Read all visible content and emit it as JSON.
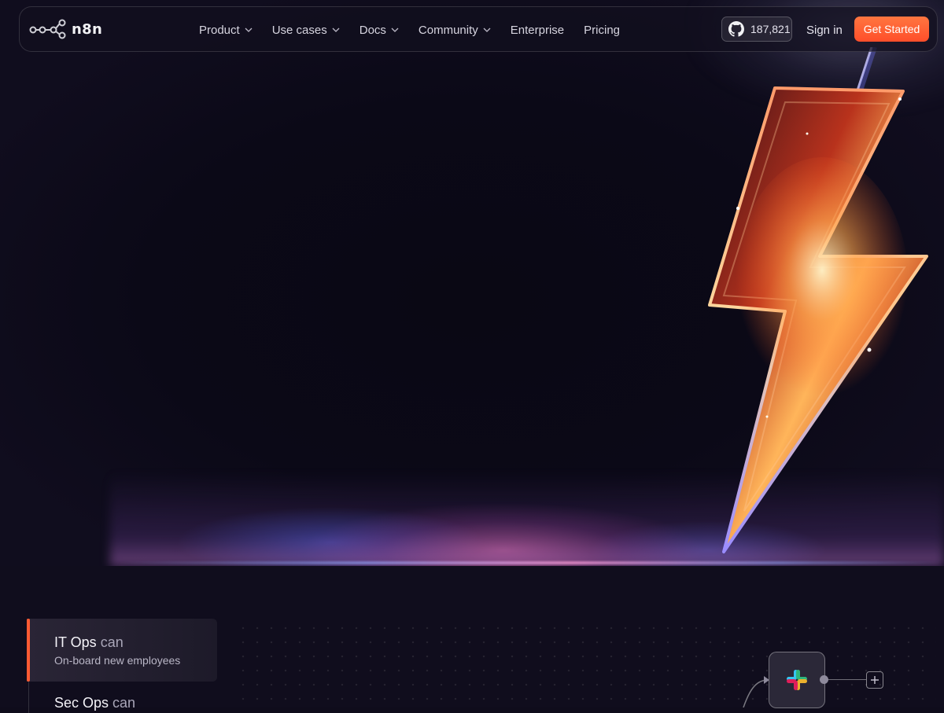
{
  "brand": {
    "name": "n8n",
    "accent_color": "#ff5a33"
  },
  "nav": {
    "items": [
      {
        "label": "Product",
        "has_dropdown": true
      },
      {
        "label": "Use cases",
        "has_dropdown": true
      },
      {
        "label": "Docs",
        "has_dropdown": true
      },
      {
        "label": "Community",
        "has_dropdown": true
      },
      {
        "label": "Enterprise",
        "has_dropdown": false
      },
      {
        "label": "Pricing",
        "has_dropdown": false
      }
    ],
    "github": {
      "icon": "github-icon",
      "stars": "187,821"
    },
    "signin_label": "Sign in",
    "cta_label": "Get Started"
  },
  "hero": {
    "illustration": "lightning-bolt"
  },
  "use_cases": {
    "active": {
      "team": "IT Ops",
      "connector": "can",
      "task": "On-board new employees"
    },
    "next": {
      "team": "Sec Ops",
      "connector": "can"
    }
  },
  "workflow": {
    "node_icon": "slack-icon",
    "add_icon": "plus-icon"
  }
}
